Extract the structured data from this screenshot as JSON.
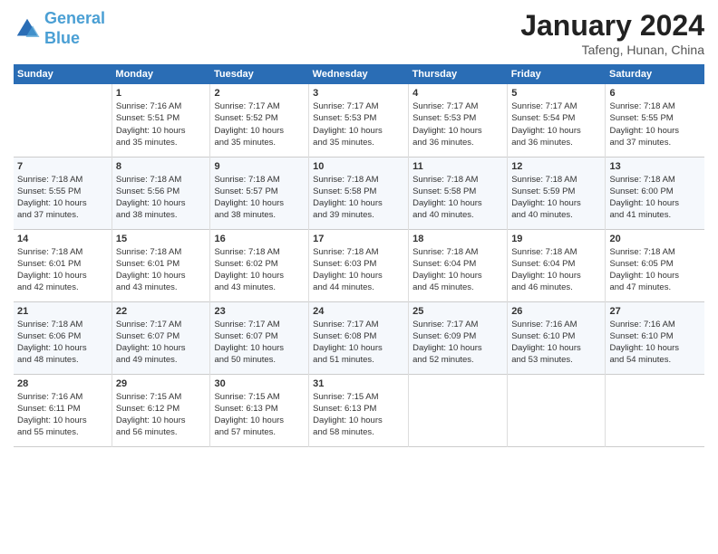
{
  "header": {
    "logo_line1": "General",
    "logo_line2": "Blue",
    "month": "January 2024",
    "location": "Tafeng, Hunan, China"
  },
  "days_of_week": [
    "Sunday",
    "Monday",
    "Tuesday",
    "Wednesday",
    "Thursday",
    "Friday",
    "Saturday"
  ],
  "weeks": [
    [
      {
        "day": "",
        "content": ""
      },
      {
        "day": "1",
        "content": "Sunrise: 7:16 AM\nSunset: 5:51 PM\nDaylight: 10 hours\nand 35 minutes."
      },
      {
        "day": "2",
        "content": "Sunrise: 7:17 AM\nSunset: 5:52 PM\nDaylight: 10 hours\nand 35 minutes."
      },
      {
        "day": "3",
        "content": "Sunrise: 7:17 AM\nSunset: 5:53 PM\nDaylight: 10 hours\nand 35 minutes."
      },
      {
        "day": "4",
        "content": "Sunrise: 7:17 AM\nSunset: 5:53 PM\nDaylight: 10 hours\nand 36 minutes."
      },
      {
        "day": "5",
        "content": "Sunrise: 7:17 AM\nSunset: 5:54 PM\nDaylight: 10 hours\nand 36 minutes."
      },
      {
        "day": "6",
        "content": "Sunrise: 7:18 AM\nSunset: 5:55 PM\nDaylight: 10 hours\nand 37 minutes."
      }
    ],
    [
      {
        "day": "7",
        "content": "Sunrise: 7:18 AM\nSunset: 5:55 PM\nDaylight: 10 hours\nand 37 minutes."
      },
      {
        "day": "8",
        "content": "Sunrise: 7:18 AM\nSunset: 5:56 PM\nDaylight: 10 hours\nand 38 minutes."
      },
      {
        "day": "9",
        "content": "Sunrise: 7:18 AM\nSunset: 5:57 PM\nDaylight: 10 hours\nand 38 minutes."
      },
      {
        "day": "10",
        "content": "Sunrise: 7:18 AM\nSunset: 5:58 PM\nDaylight: 10 hours\nand 39 minutes."
      },
      {
        "day": "11",
        "content": "Sunrise: 7:18 AM\nSunset: 5:58 PM\nDaylight: 10 hours\nand 40 minutes."
      },
      {
        "day": "12",
        "content": "Sunrise: 7:18 AM\nSunset: 5:59 PM\nDaylight: 10 hours\nand 40 minutes."
      },
      {
        "day": "13",
        "content": "Sunrise: 7:18 AM\nSunset: 6:00 PM\nDaylight: 10 hours\nand 41 minutes."
      }
    ],
    [
      {
        "day": "14",
        "content": "Sunrise: 7:18 AM\nSunset: 6:01 PM\nDaylight: 10 hours\nand 42 minutes."
      },
      {
        "day": "15",
        "content": "Sunrise: 7:18 AM\nSunset: 6:01 PM\nDaylight: 10 hours\nand 43 minutes."
      },
      {
        "day": "16",
        "content": "Sunrise: 7:18 AM\nSunset: 6:02 PM\nDaylight: 10 hours\nand 43 minutes."
      },
      {
        "day": "17",
        "content": "Sunrise: 7:18 AM\nSunset: 6:03 PM\nDaylight: 10 hours\nand 44 minutes."
      },
      {
        "day": "18",
        "content": "Sunrise: 7:18 AM\nSunset: 6:04 PM\nDaylight: 10 hours\nand 45 minutes."
      },
      {
        "day": "19",
        "content": "Sunrise: 7:18 AM\nSunset: 6:04 PM\nDaylight: 10 hours\nand 46 minutes."
      },
      {
        "day": "20",
        "content": "Sunrise: 7:18 AM\nSunset: 6:05 PM\nDaylight: 10 hours\nand 47 minutes."
      }
    ],
    [
      {
        "day": "21",
        "content": "Sunrise: 7:18 AM\nSunset: 6:06 PM\nDaylight: 10 hours\nand 48 minutes."
      },
      {
        "day": "22",
        "content": "Sunrise: 7:17 AM\nSunset: 6:07 PM\nDaylight: 10 hours\nand 49 minutes."
      },
      {
        "day": "23",
        "content": "Sunrise: 7:17 AM\nSunset: 6:07 PM\nDaylight: 10 hours\nand 50 minutes."
      },
      {
        "day": "24",
        "content": "Sunrise: 7:17 AM\nSunset: 6:08 PM\nDaylight: 10 hours\nand 51 minutes."
      },
      {
        "day": "25",
        "content": "Sunrise: 7:17 AM\nSunset: 6:09 PM\nDaylight: 10 hours\nand 52 minutes."
      },
      {
        "day": "26",
        "content": "Sunrise: 7:16 AM\nSunset: 6:10 PM\nDaylight: 10 hours\nand 53 minutes."
      },
      {
        "day": "27",
        "content": "Sunrise: 7:16 AM\nSunset: 6:10 PM\nDaylight: 10 hours\nand 54 minutes."
      }
    ],
    [
      {
        "day": "28",
        "content": "Sunrise: 7:16 AM\nSunset: 6:11 PM\nDaylight: 10 hours\nand 55 minutes."
      },
      {
        "day": "29",
        "content": "Sunrise: 7:15 AM\nSunset: 6:12 PM\nDaylight: 10 hours\nand 56 minutes."
      },
      {
        "day": "30",
        "content": "Sunrise: 7:15 AM\nSunset: 6:13 PM\nDaylight: 10 hours\nand 57 minutes."
      },
      {
        "day": "31",
        "content": "Sunrise: 7:15 AM\nSunset: 6:13 PM\nDaylight: 10 hours\nand 58 minutes."
      },
      {
        "day": "",
        "content": ""
      },
      {
        "day": "",
        "content": ""
      },
      {
        "day": "",
        "content": ""
      }
    ]
  ]
}
